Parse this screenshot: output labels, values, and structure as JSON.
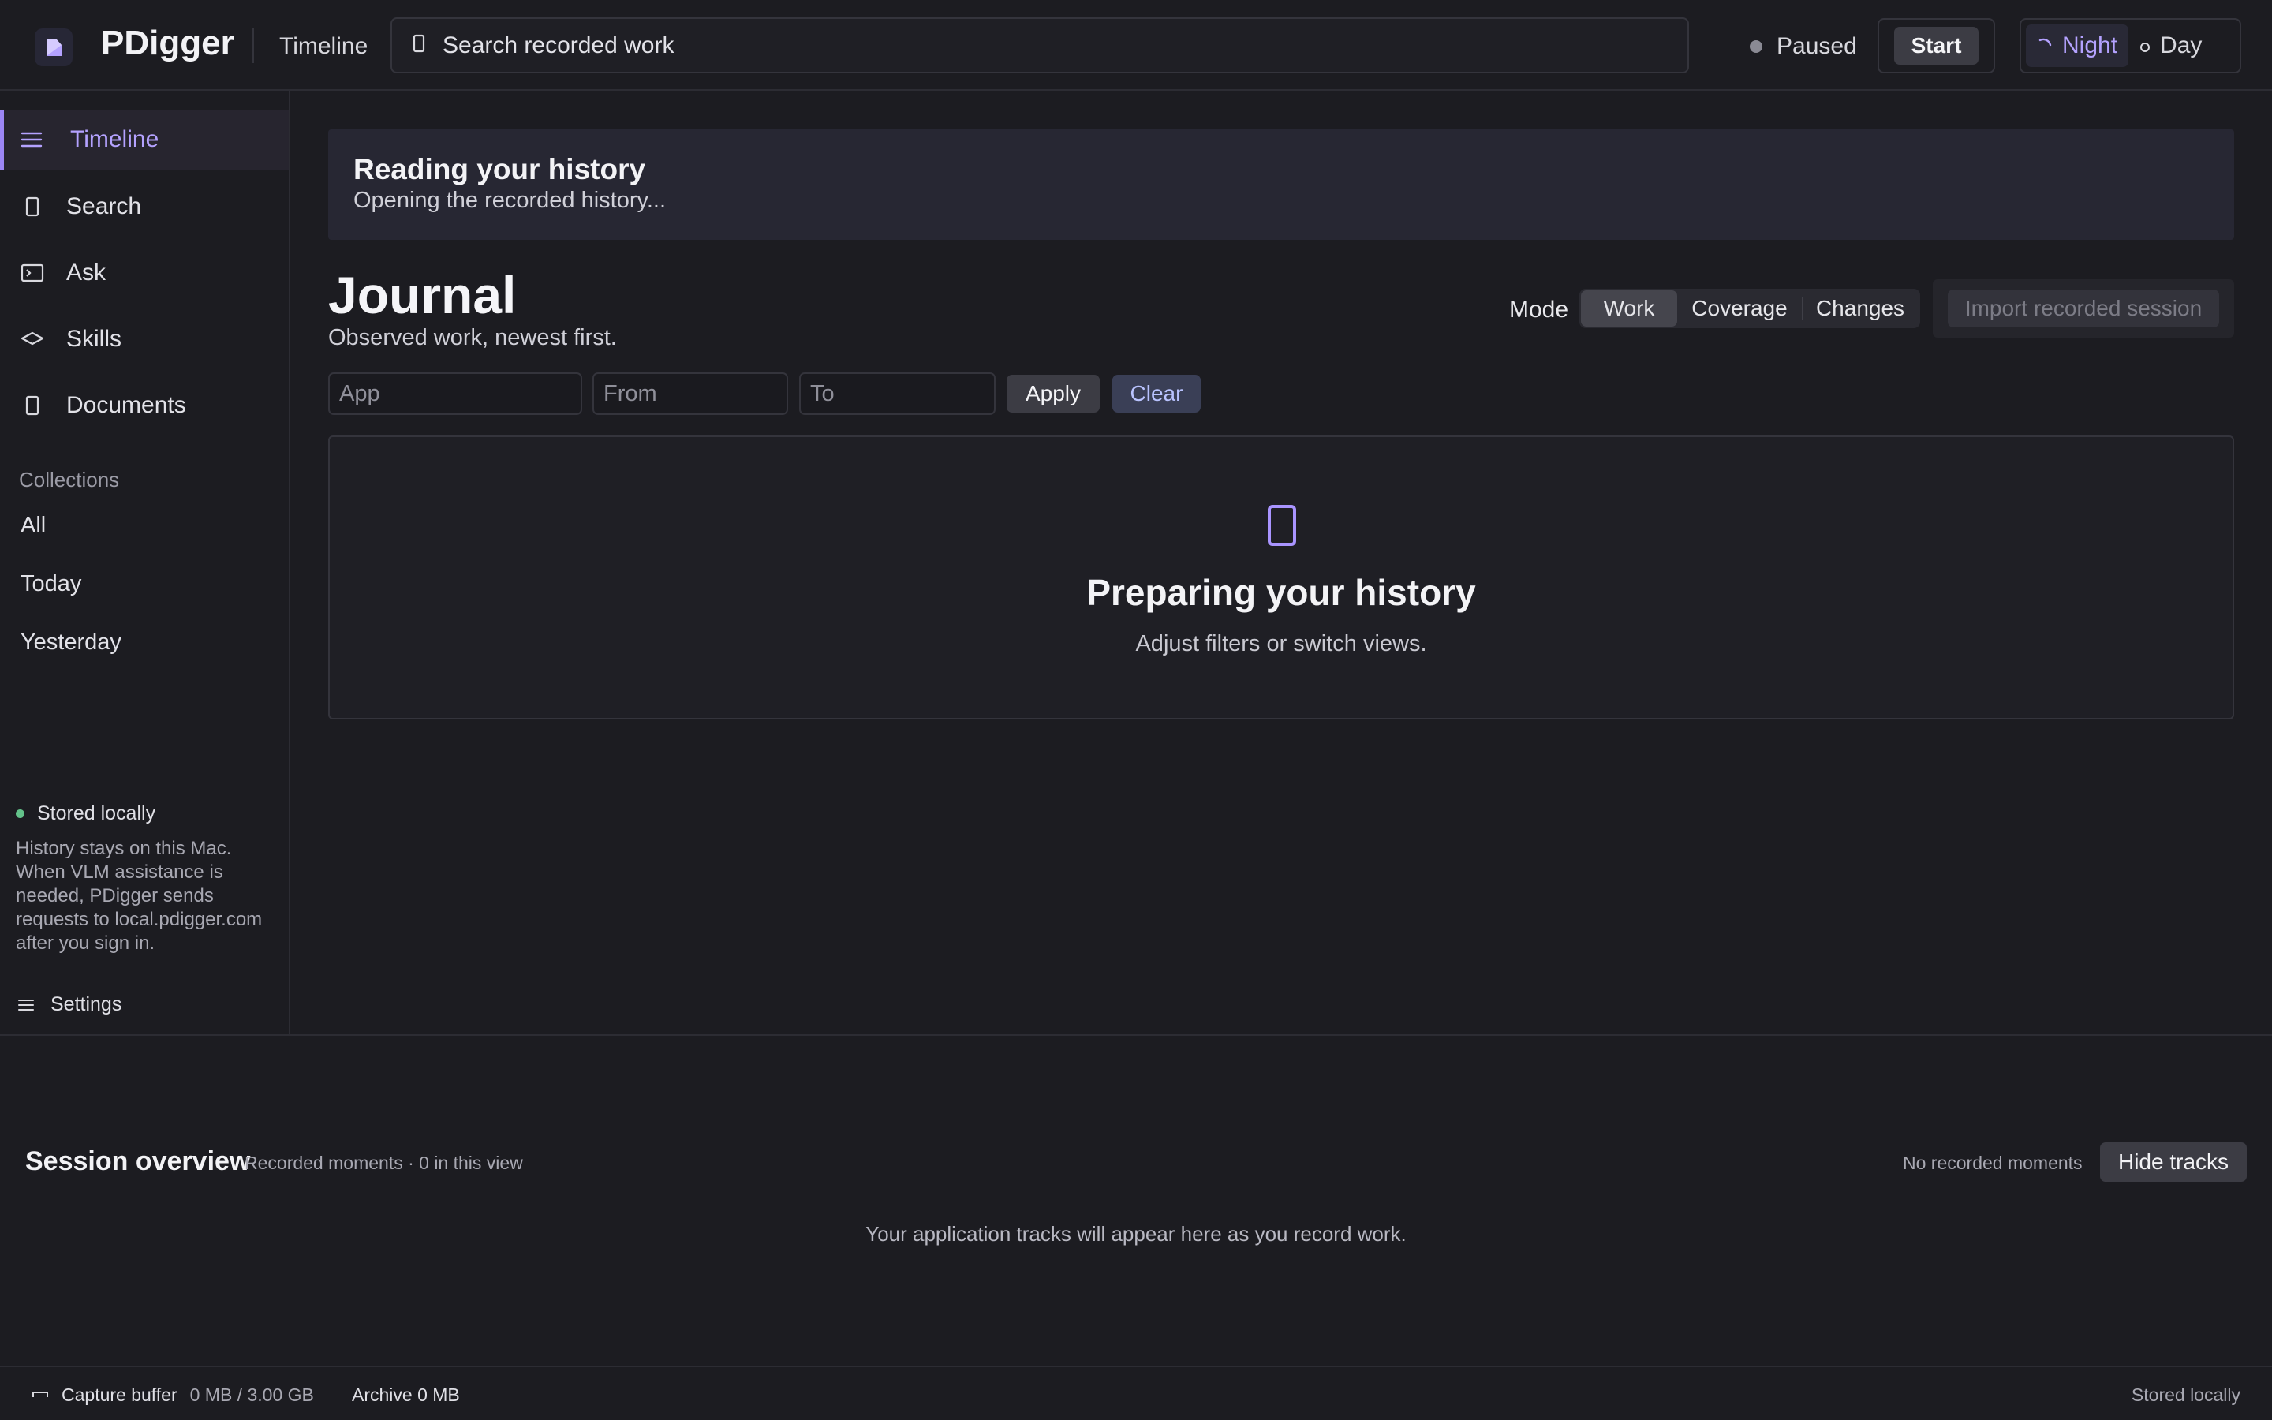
{
  "header": {
    "app_name": "PDigger",
    "crumb": "Timeline",
    "search_placeholder": "Search recorded work",
    "status": "Paused",
    "start_label": "Start",
    "theme": {
      "night": "Night",
      "day": "Day",
      "active": "Night"
    }
  },
  "sidebar": {
    "items": [
      {
        "label": "Timeline",
        "icon": "list-icon",
        "active": true
      },
      {
        "label": "Search",
        "icon": "doc-icon",
        "active": false
      },
      {
        "label": "Ask",
        "icon": "terminal-icon",
        "active": false
      },
      {
        "label": "Skills",
        "icon": "layers-icon",
        "active": false
      },
      {
        "label": "Documents",
        "icon": "doc-icon",
        "active": false
      }
    ],
    "collections_header": "Collections",
    "collections": [
      "All",
      "Today",
      "Yesterday"
    ],
    "stored_label": "Stored locally",
    "stored_desc": "History stays on this Mac. When VLM assistance is needed, PDigger sends requests to local.pdigger.com after you sign in.",
    "settings_label": "Settings"
  },
  "banner": {
    "title": "Reading your history",
    "subtitle": "Opening the recorded history..."
  },
  "main": {
    "title": "Journal",
    "subtitle": "Observed work, newest first.",
    "mode_label": "Mode",
    "modes": [
      "Work",
      "Coverage",
      "Changes"
    ],
    "active_mode": "Work",
    "import_label": "Import recorded session",
    "filters": {
      "app_placeholder": "App",
      "from_placeholder": "From",
      "to_placeholder": "To",
      "apply_label": "Apply",
      "clear_label": "Clear"
    },
    "empty": {
      "title": "Preparing your history",
      "subtitle": "Adjust filters or switch views."
    }
  },
  "overview": {
    "title": "Session overview",
    "meta": "Recorded moments · 0 in this view",
    "none_label": "No recorded moments",
    "hide_label": "Hide tracks",
    "empty_text": "Your application tracks will appear here as you record work."
  },
  "footer": {
    "buffer_label": "Capture buffer",
    "buffer_value": "0 MB / 3.00 GB",
    "archive_label": "Archive 0 MB",
    "right_label": "Stored locally"
  },
  "colors": {
    "accent": "#9c86f5",
    "background": "#1c1c21",
    "stored_dot": "#63c28a"
  }
}
